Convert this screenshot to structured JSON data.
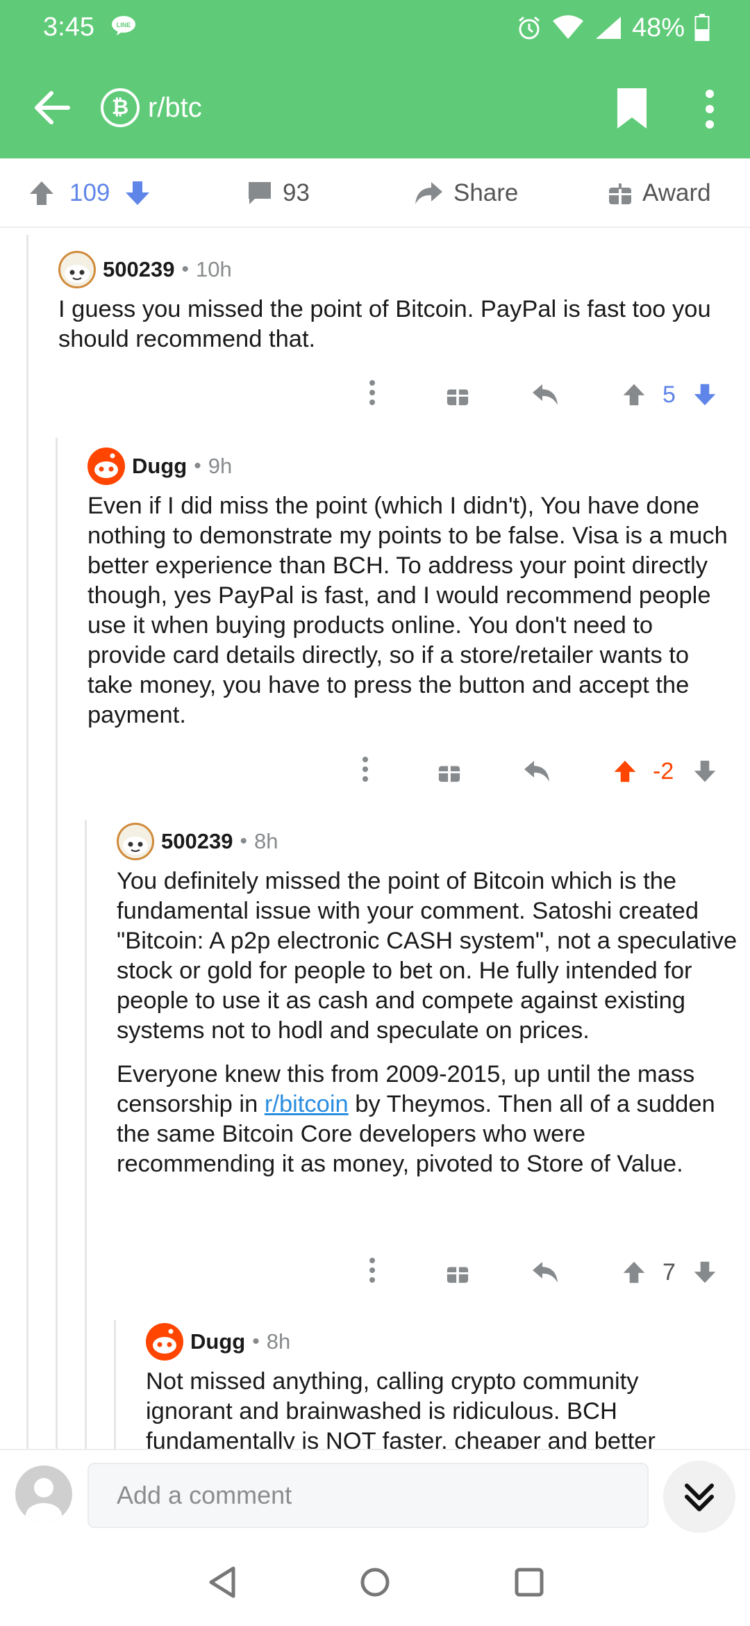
{
  "status": {
    "time": "3:45",
    "battery": "48%"
  },
  "header": {
    "subreddit": "r/btc",
    "badge": "₿"
  },
  "post_actions": {
    "score": "109",
    "comments": "93",
    "share_label": "Share",
    "award_label": "Award"
  },
  "colors": {
    "header": "#5fcb78",
    "upvote_active": "#ff4500",
    "downvote_active": "#7193ff",
    "link": "#2a8de0"
  },
  "comments": [
    {
      "author": "500239",
      "age": "10h",
      "body": [
        "I guess you missed the point of Bitcoin. PayPal is fast too you should recommend that."
      ],
      "score": "5"
    },
    {
      "author": "Dugg",
      "age": "9h",
      "body": [
        "Even if I did miss the point (which I didn't), You have done nothing to demonstrate my points to be false. Visa is a much better experience than BCH. To address your point directly though, yes PayPal is fast, and I would recommend people use it when buying products online. You don't need to provide card details directly, so if a store/retailer wants to take money, you have to press the button and accept the payment."
      ],
      "score": "-2"
    },
    {
      "author": "500239",
      "age": "8h",
      "body": [
        "You definitely missed the point of Bitcoin which is the fundamental issue with your comment. Satoshi created \"Bitcoin: A p2p electronic CASH system\", not a speculative stock or gold for people to bet on. He fully intended for people to use it as cash and compete against existing systems not to hodl and speculate on prices."
      ],
      "body2_before": "Everyone knew this from 2009-2015, up until the mass censorship in ",
      "body2_link": "r/bitcoin",
      "body2_after": " by Theymos. Then all of a sudden the same Bitcoin Core developers who were recommending it as money, pivoted to Store of Value.",
      "score": "7"
    },
    {
      "author": "Dugg",
      "age": "8h",
      "body": [
        "Not missed anything, calling crypto community ignorant and brainwashed is ridiculous. BCH fundamentally is NOT faster, cheaper and better"
      ]
    }
  ],
  "composer": {
    "placeholder": "Add a comment"
  },
  "separator": "•"
}
